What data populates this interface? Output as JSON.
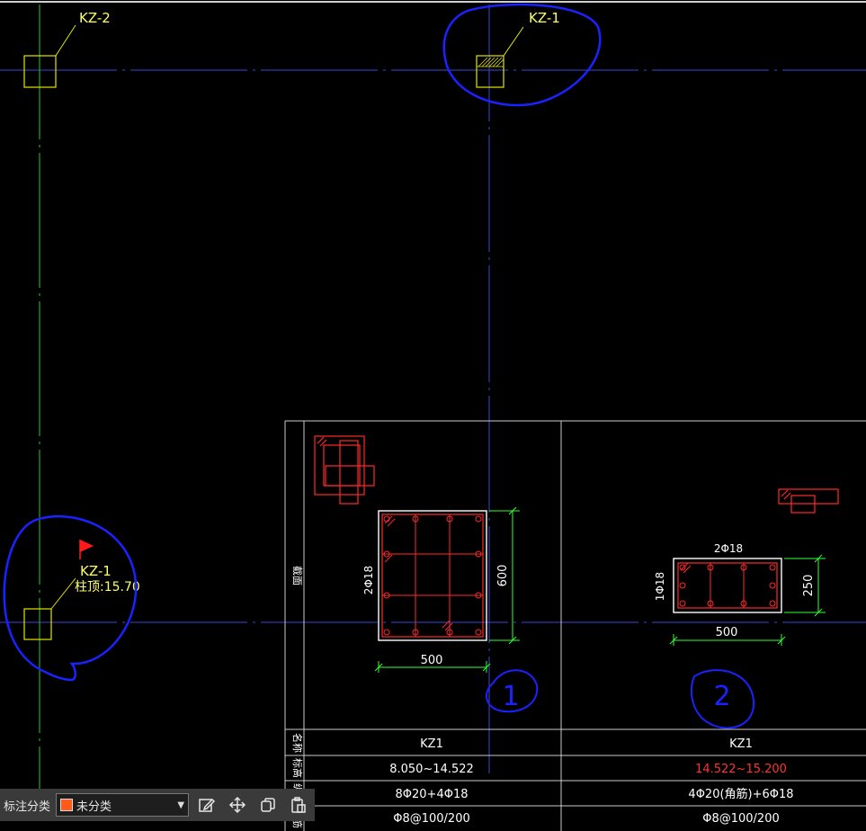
{
  "colors": {
    "background": "#000000",
    "axis": "#3a46d8",
    "column": "#e6e600",
    "annotation_yellow": "#ffff66",
    "markup_blue": "#1a22ff",
    "rebar_red": "#ff2a2a",
    "dimension_green": "#33ff33",
    "table_grid": "#cccccc",
    "table_text": "#ffffff",
    "highlight_red": "#ff3333",
    "flag": "#ff1a1a",
    "category_swatch": "#ff5a1a"
  },
  "columns": {
    "top_left_label": "KZ-2",
    "top_right_label": "KZ-1",
    "bottom_left_label": "KZ-1",
    "bottom_left_note": "柱顶:15.70"
  },
  "sections": {
    "s1": {
      "width_dim": "500",
      "height_dim": "600",
      "side_rebar": "2Φ18"
    },
    "s2": {
      "width_dim": "500",
      "height_dim": "250",
      "top_rebar": "2Φ18",
      "side_rebar": "1Φ18"
    }
  },
  "handwritten": {
    "mark1": "1",
    "mark2": "2"
  },
  "table": {
    "row_headers": {
      "section": "截面",
      "name": "名称",
      "elevation": "标高",
      "longitudinal": "纵筋",
      "stirrup": "箍筋"
    },
    "col1": {
      "name": "KZ1",
      "elevation": "8.050~14.522",
      "longitudinal": "8Φ20+4Φ18",
      "stirrup": "Φ8@100/200"
    },
    "col2": {
      "name": "KZ1",
      "elevation": "14.522~15.200",
      "longitudinal": "4Φ20(角筋)+6Φ18",
      "stirrup": "Φ8@100/200"
    }
  },
  "toolbar": {
    "label": "标注分类",
    "selected": "未分类",
    "icons": [
      "edit-icon",
      "move-icon",
      "copy-icon",
      "paste-icon"
    ]
  }
}
